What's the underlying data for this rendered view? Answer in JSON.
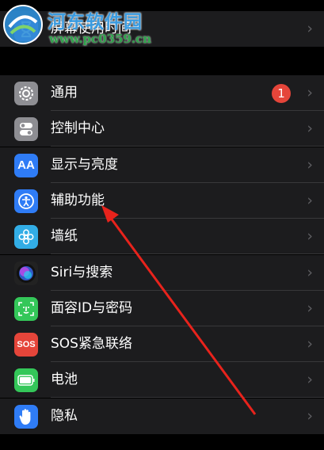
{
  "top_row": {
    "label": "屏幕使用时间"
  },
  "settings": [
    {
      "id": "general",
      "label": "通用",
      "badge": "1",
      "icon": "gear-icon",
      "color": "#8e8e93"
    },
    {
      "id": "control-center",
      "label": "控制中心",
      "icon": "toggles-icon",
      "color": "#8e8e93"
    },
    {
      "id": "display",
      "label": "显示与亮度",
      "icon": "text-size-icon",
      "color": "#2f7cf6"
    },
    {
      "id": "accessibility",
      "label": "辅助功能",
      "icon": "accessibility-icon",
      "color": "#2f7cf6"
    },
    {
      "id": "wallpaper",
      "label": "墙纸",
      "icon": "flower-icon",
      "color": "#32ade6"
    },
    {
      "id": "siri",
      "label": "Siri与搜索",
      "icon": "siri-icon",
      "color": "#222"
    },
    {
      "id": "faceid",
      "label": "面容ID与密码",
      "icon": "face-id-icon",
      "color": "#34c759"
    },
    {
      "id": "sos",
      "label": "SOS紧急联络",
      "icon": "sos-icon",
      "icon_text": "SOS",
      "color": "#e5453a"
    },
    {
      "id": "battery",
      "label": "电池",
      "icon": "battery-icon",
      "color": "#34c759"
    },
    {
      "id": "privacy",
      "label": "隐私",
      "icon": "hand-icon",
      "color": "#2f7cf6"
    }
  ],
  "watermark": {
    "title": "河东软件园",
    "url": "www.pc0359.cn"
  },
  "chevron": "›"
}
